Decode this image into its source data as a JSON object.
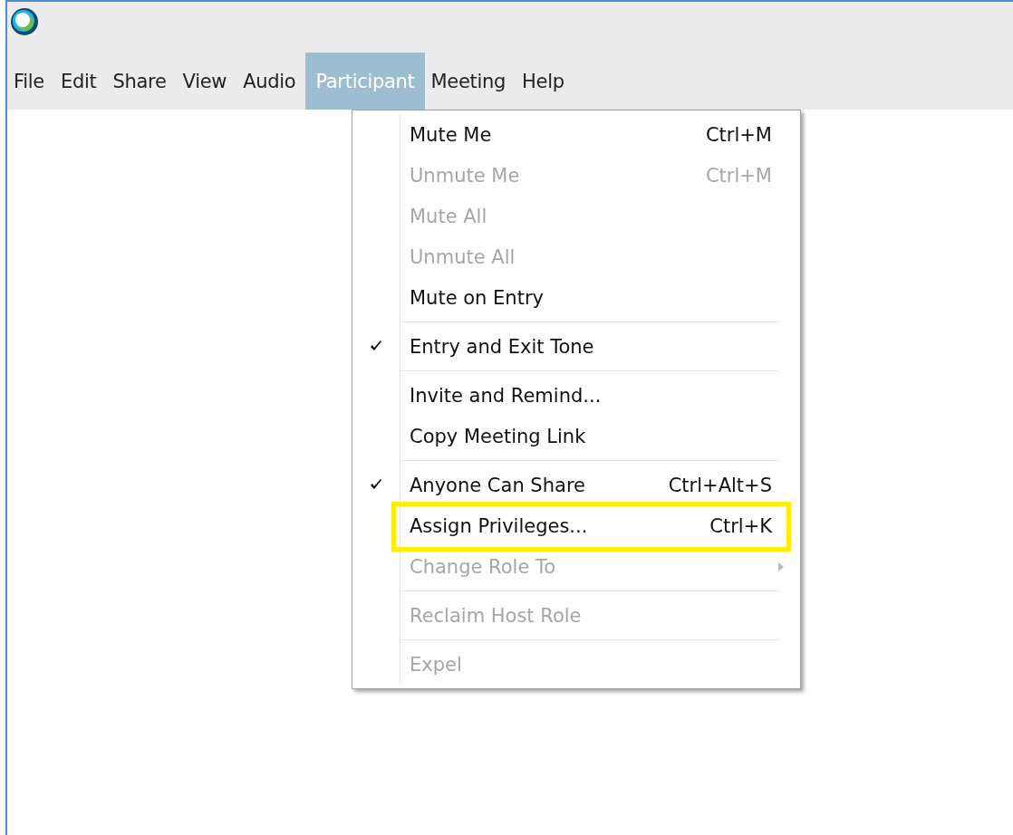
{
  "menu_bar": [
    {
      "label": "File",
      "selected": false
    },
    {
      "label": "Edit",
      "selected": false
    },
    {
      "label": "Share",
      "selected": false
    },
    {
      "label": "View",
      "selected": false
    },
    {
      "label": "Audio",
      "selected": false
    },
    {
      "label": "Participant",
      "selected": true
    },
    {
      "label": "Meeting",
      "selected": false
    },
    {
      "label": "Help",
      "selected": false
    }
  ],
  "participant_menu": [
    {
      "kind": "item",
      "label": "Mute Me",
      "shortcut": "Ctrl+M",
      "disabled": false,
      "checked": false,
      "highlighted": false,
      "submenu": false
    },
    {
      "kind": "item",
      "label": "Unmute Me",
      "shortcut": "Ctrl+M",
      "disabled": true,
      "checked": false,
      "highlighted": false,
      "submenu": false
    },
    {
      "kind": "item",
      "label": "Mute All",
      "disabled": true,
      "checked": false,
      "highlighted": false,
      "submenu": false
    },
    {
      "kind": "item",
      "label": "Unmute All",
      "disabled": true,
      "checked": false,
      "highlighted": false,
      "submenu": false
    },
    {
      "kind": "item",
      "label": "Mute on Entry",
      "disabled": false,
      "checked": false,
      "highlighted": false,
      "submenu": false
    },
    {
      "kind": "separator"
    },
    {
      "kind": "item",
      "label": "Entry and Exit Tone",
      "disabled": false,
      "checked": true,
      "highlighted": false,
      "submenu": false
    },
    {
      "kind": "separator"
    },
    {
      "kind": "item",
      "label": "Invite and Remind...",
      "disabled": false,
      "checked": false,
      "highlighted": false,
      "submenu": false
    },
    {
      "kind": "item",
      "label": "Copy Meeting Link",
      "disabled": false,
      "checked": false,
      "highlighted": false,
      "submenu": false
    },
    {
      "kind": "separator"
    },
    {
      "kind": "item",
      "label": "Anyone Can Share",
      "shortcut": "Ctrl+Alt+S",
      "disabled": false,
      "checked": true,
      "highlighted": false,
      "submenu": false
    },
    {
      "kind": "item",
      "label": "Assign Privileges...",
      "shortcut": "Ctrl+K",
      "disabled": false,
      "checked": false,
      "highlighted": true,
      "submenu": false
    },
    {
      "kind": "item",
      "label": "Change Role To",
      "disabled": true,
      "checked": false,
      "highlighted": false,
      "submenu": true
    },
    {
      "kind": "separator"
    },
    {
      "kind": "item",
      "label": "Reclaim Host Role",
      "disabled": true,
      "checked": false,
      "highlighted": false,
      "submenu": false
    },
    {
      "kind": "separator"
    },
    {
      "kind": "item",
      "label": "Expel",
      "disabled": true,
      "checked": false,
      "highlighted": false,
      "submenu": false
    }
  ]
}
